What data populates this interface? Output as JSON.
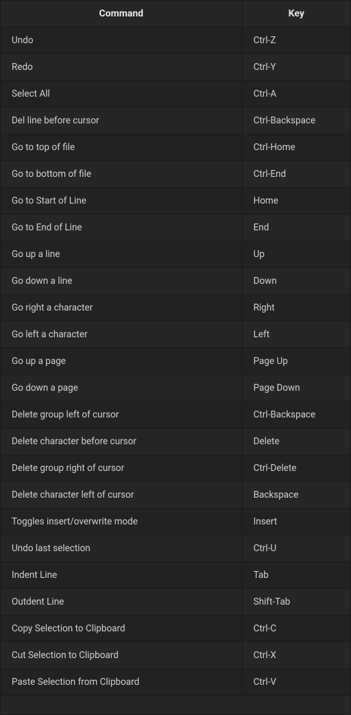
{
  "headers": {
    "command": "Command",
    "key": "Key"
  },
  "shortcuts": [
    {
      "command": "Undo",
      "key": "Ctrl-Z"
    },
    {
      "command": "Redo",
      "key": "Ctrl-Y"
    },
    {
      "command": "Select All",
      "key": "Ctrl-A"
    },
    {
      "command": "Del line before cursor",
      "key": "Ctrl-Backspace"
    },
    {
      "command": "Go to top of file",
      "key": "Ctrl-Home"
    },
    {
      "command": "Go to bottom of file",
      "key": "Ctrl-End"
    },
    {
      "command": "Go to Start of Line",
      "key": "Home"
    },
    {
      "command": "Go to End of Line",
      "key": "End"
    },
    {
      "command": "Go up a line",
      "key": "Up"
    },
    {
      "command": "Go down a line",
      "key": "Down"
    },
    {
      "command": "Go right a character",
      "key": "Right"
    },
    {
      "command": "Go left a character",
      "key": "Left"
    },
    {
      "command": "Go up a page",
      "key": "Page Up"
    },
    {
      "command": "Go down a page",
      "key": "Page Down"
    },
    {
      "command": "Delete group left of cursor",
      "key": "Ctrl-Backspace"
    },
    {
      "command": "Delete character before cursor",
      "key": "Delete"
    },
    {
      "command": "Delete group right of cursor",
      "key": "Ctrl-Delete"
    },
    {
      "command": "Delete character left of cursor",
      "key": "Backspace"
    },
    {
      "command": "Toggles insert/overwrite mode",
      "key": "Insert"
    },
    {
      "command": "Undo last selection",
      "key": "Ctrl-U"
    },
    {
      "command": "Indent Line",
      "key": "Tab"
    },
    {
      "command": "Outdent Line",
      "key": "Shift-Tab"
    },
    {
      "command": "Copy Selection to Clipboard",
      "key": "Ctrl-C"
    },
    {
      "command": "Cut Selection to Clipboard",
      "key": "Ctrl-X"
    },
    {
      "command": "Paste Selection from Clipboard",
      "key": "Ctrl-V"
    }
  ]
}
